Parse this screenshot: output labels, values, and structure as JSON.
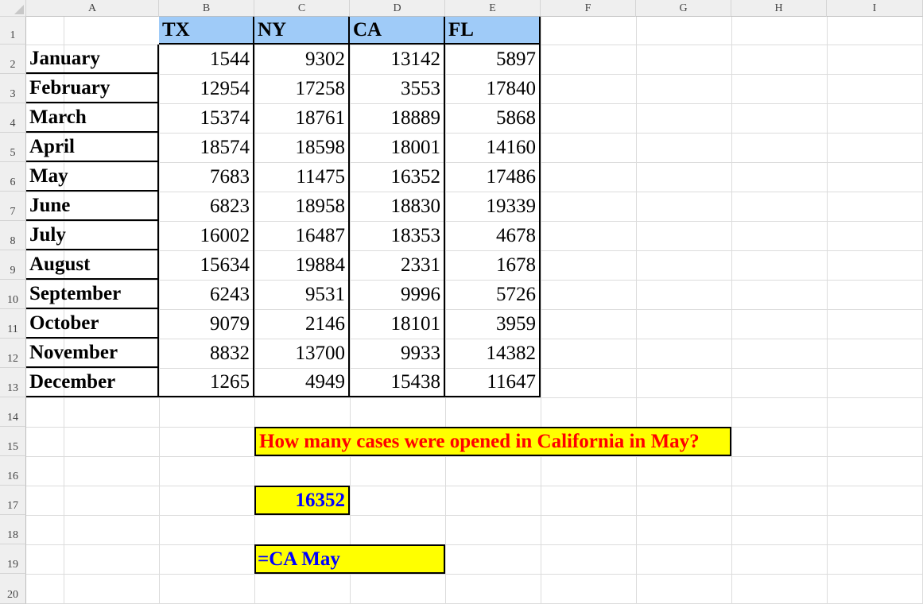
{
  "columns": [
    "A",
    "B",
    "C",
    "D",
    "E",
    "F",
    "G",
    "H",
    "I"
  ],
  "rows": [
    "1",
    "2",
    "3",
    "4",
    "5",
    "6",
    "7",
    "8",
    "9",
    "10",
    "11",
    "12",
    "13",
    "14",
    "15",
    "16",
    "17",
    "18",
    "19",
    "20"
  ],
  "headers": [
    "TX",
    "NY",
    "CA",
    "FL"
  ],
  "table": [
    {
      "month": "January",
      "values": [
        "1544",
        "9302",
        "13142",
        "5897"
      ]
    },
    {
      "month": "February",
      "values": [
        "12954",
        "17258",
        "3553",
        "17840"
      ]
    },
    {
      "month": "March",
      "values": [
        "15374",
        "18761",
        "18889",
        "5868"
      ]
    },
    {
      "month": "April",
      "values": [
        "18574",
        "18598",
        "18001",
        "14160"
      ]
    },
    {
      "month": "May",
      "values": [
        "7683",
        "11475",
        "16352",
        "17486"
      ]
    },
    {
      "month": "June",
      "values": [
        "6823",
        "18958",
        "18830",
        "19339"
      ]
    },
    {
      "month": "July",
      "values": [
        "16002",
        "16487",
        "18353",
        "4678"
      ]
    },
    {
      "month": "August",
      "values": [
        "15634",
        "19884",
        "2331",
        "1678"
      ]
    },
    {
      "month": "September",
      "values": [
        "6243",
        "9531",
        "9996",
        "5726"
      ]
    },
    {
      "month": "October",
      "values": [
        "9079",
        "2146",
        "18101",
        "3959"
      ]
    },
    {
      "month": "November",
      "values": [
        "8832",
        "13700",
        "9933",
        "14382"
      ]
    },
    {
      "month": "December",
      "values": [
        "1265",
        "4949",
        "15438",
        "11647"
      ]
    }
  ],
  "question": "How many cases were opened in California in May?",
  "answer": "16352",
  "formula": "=CA May",
  "colors": {
    "header_fill": "#9fcbf8",
    "highlight_fill": "#ffff00",
    "question_text": "#ff0000",
    "answer_text": "#0000ff"
  }
}
